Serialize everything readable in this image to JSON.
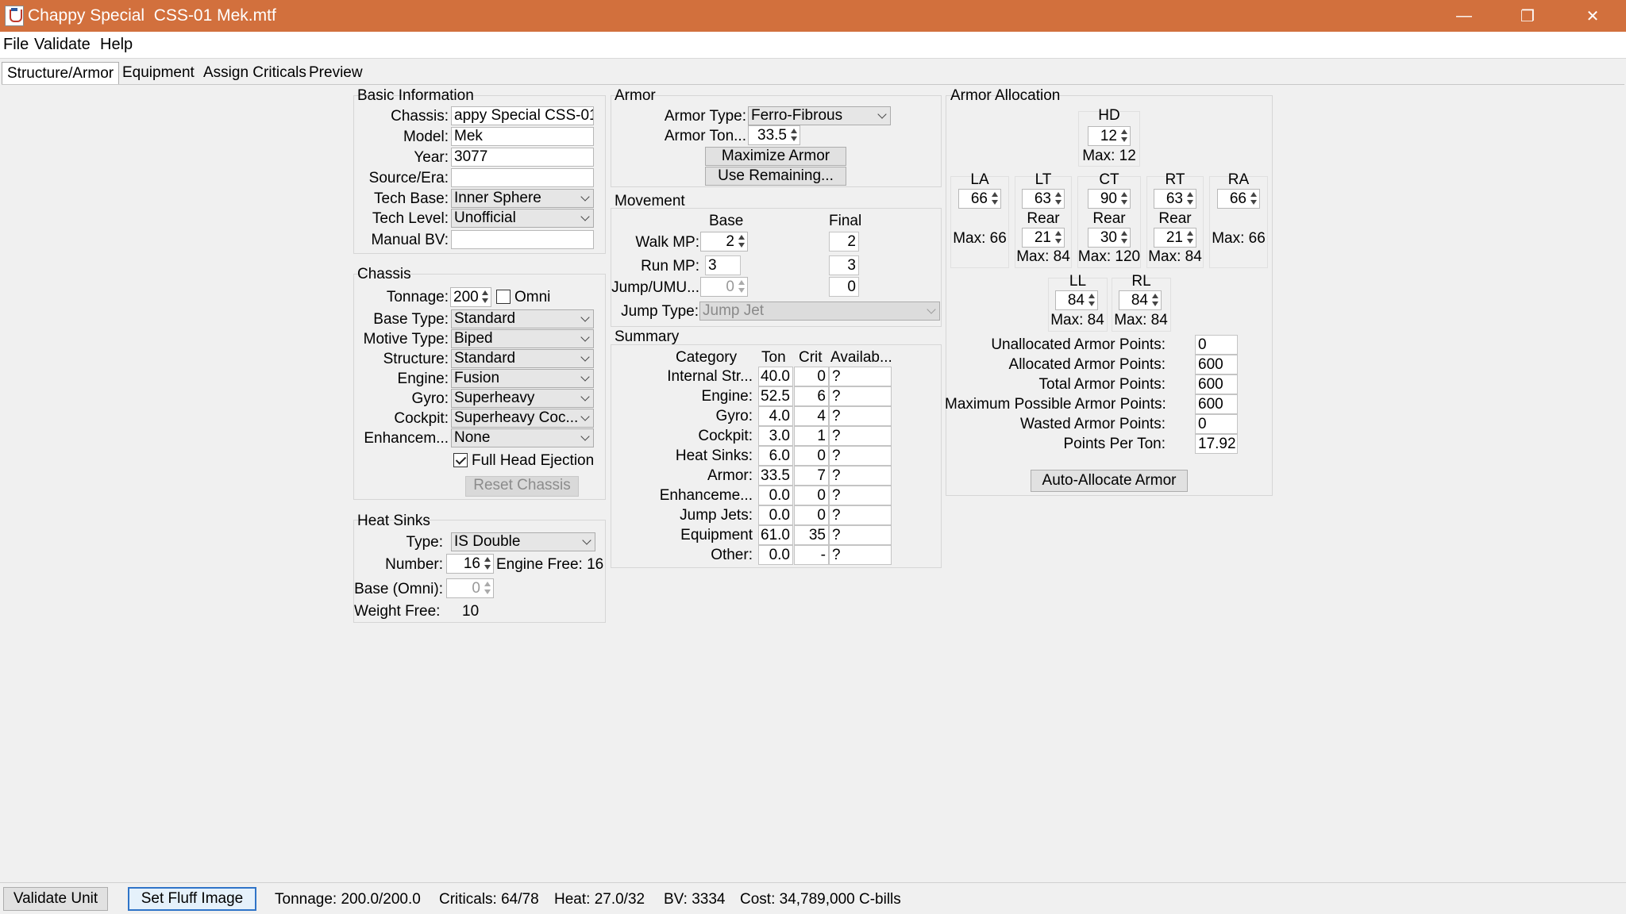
{
  "window": {
    "title": "Chappy Special  CSS-01 Mek.mtf",
    "minimize": "—",
    "restore": "❐",
    "close": "✕"
  },
  "menu": [
    "File",
    "Validate",
    "Help"
  ],
  "tabs": [
    "Structure/Armor",
    "Equipment",
    "Assign Criticals",
    "Preview"
  ],
  "basic_info": {
    "title": "Basic Information",
    "chassis_label": "Chassis:",
    "chassis": "appy Special  CSS-01",
    "model_label": "Model:",
    "model": "Mek",
    "year_label": "Year:",
    "year": "3077",
    "source_label": "Source/Era:",
    "source": "",
    "techbase_label": "Tech Base:",
    "techbase": "Inner Sphere",
    "techlevel_label": "Tech Level:",
    "techlevel": "Unofficial",
    "manualbv_label": "Manual BV:",
    "manualbv": ""
  },
  "chassis": {
    "title": "Chassis",
    "tonnage_label": "Tonnage:",
    "tonnage": "200",
    "omni_label": "Omni",
    "basetype_label": "Base Type:",
    "basetype": "Standard",
    "motive_label": "Motive Type:",
    "motive": "Biped",
    "structure_label": "Structure:",
    "structure": "Standard",
    "engine_label": "Engine:",
    "engine": "Fusion",
    "gyro_label": "Gyro:",
    "gyro": "Superheavy",
    "cockpit_label": "Cockpit:",
    "cockpit": "Superheavy Coc...",
    "enhancement_label": "Enhancem...",
    "enhancement": "None",
    "full_head_ejection_label": "Full Head Ejection",
    "reset_label": "Reset Chassis"
  },
  "heat_sinks": {
    "title": "Heat Sinks",
    "type_label": "Type:",
    "type": "IS Double",
    "number_label": "Number:",
    "number": "16",
    "engine_free": "Engine Free: 16",
    "base_omni_label": "Base (Omni):",
    "base_omni": "0",
    "weight_free_label": "Weight Free:",
    "weight_free": "10"
  },
  "armor": {
    "title": "Armor",
    "type_label": "Armor Type:",
    "type": "Ferro-Fibrous",
    "tonnage_label": "Armor Ton...",
    "tonnage": "33.5",
    "maximize_label": "Maximize Armor",
    "use_remaining_label": "Use Remaining..."
  },
  "movement": {
    "title": "Movement",
    "base_header": "Base",
    "final_header": "Final",
    "walk_label": "Walk MP:",
    "walk_base": "2",
    "walk_final": "2",
    "run_label": "Run MP:",
    "run_base": "3",
    "run_final": "3",
    "jump_label": "Jump/UMU...",
    "jump_base": "0",
    "jump_final": "0",
    "jumptype_label": "Jump Type:",
    "jumptype": "Jump Jet"
  },
  "summary": {
    "title": "Summary",
    "headers": [
      "Category",
      "Ton",
      "Crit",
      "Availab..."
    ],
    "rows": [
      {
        "cat": "Internal Str...",
        "ton": "40.0",
        "crit": "0",
        "avail": "?"
      },
      {
        "cat": "Engine:",
        "ton": "52.5",
        "crit": "6",
        "avail": "?"
      },
      {
        "cat": "Gyro:",
        "ton": "4.0",
        "crit": "4",
        "avail": "?"
      },
      {
        "cat": "Cockpit:",
        "ton": "3.0",
        "crit": "1",
        "avail": "?"
      },
      {
        "cat": "Heat Sinks:",
        "ton": "6.0",
        "crit": "0",
        "avail": "?"
      },
      {
        "cat": "Armor:",
        "ton": "33.5",
        "crit": "7",
        "avail": "?"
      },
      {
        "cat": "Enhanceme...",
        "ton": "0.0",
        "crit": "0",
        "avail": "?"
      },
      {
        "cat": "Jump Jets:",
        "ton": "0.0",
        "crit": "0",
        "avail": "?"
      },
      {
        "cat": "Equipment",
        "ton": "61.0",
        "crit": "35",
        "avail": "?"
      },
      {
        "cat": "Other:",
        "ton": "0.0",
        "crit": "-",
        "avail": "?"
      }
    ]
  },
  "allocation": {
    "title": "Armor Allocation",
    "hd": {
      "label": "HD",
      "value": "12",
      "max": "Max: 12"
    },
    "la": {
      "label": "LA",
      "value": "66",
      "max": "Max: 66"
    },
    "lt": {
      "label": "LT",
      "value": "63",
      "rear_label": "Rear",
      "rear": "21",
      "max": "Max: 84"
    },
    "ct": {
      "label": "CT",
      "value": "90",
      "rear_label": "Rear",
      "rear": "30",
      "max": "Max: 120"
    },
    "rt": {
      "label": "RT",
      "value": "63",
      "rear_label": "Rear",
      "rear": "21",
      "max": "Max: 84"
    },
    "ra": {
      "label": "RA",
      "value": "66",
      "max": "Max: 66"
    },
    "ll": {
      "label": "LL",
      "value": "84",
      "max": "Max: 84"
    },
    "rl": {
      "label": "RL",
      "value": "84",
      "max": "Max: 84"
    },
    "stats": [
      {
        "label": "Unallocated Armor Points:",
        "value": "0"
      },
      {
        "label": "Allocated Armor Points:",
        "value": "600"
      },
      {
        "label": "Total Armor Points:",
        "value": "600"
      },
      {
        "label": "Maximum Possible Armor Points:",
        "value": "600"
      },
      {
        "label": "Wasted Armor Points:",
        "value": "0"
      },
      {
        "label": "Points Per Ton:",
        "value": "17.92"
      }
    ],
    "auto_label": "Auto-Allocate Armor"
  },
  "status": {
    "validate_label": "Validate Unit",
    "fluff_label": "Set Fluff Image",
    "tonnage": "Tonnage: 200.0/200.0",
    "criticals": "Criticals: 64/78",
    "heat": "Heat: 27.0/32",
    "bv": "BV: 3334",
    "cost": "Cost: 34,789,000 C-bills"
  }
}
